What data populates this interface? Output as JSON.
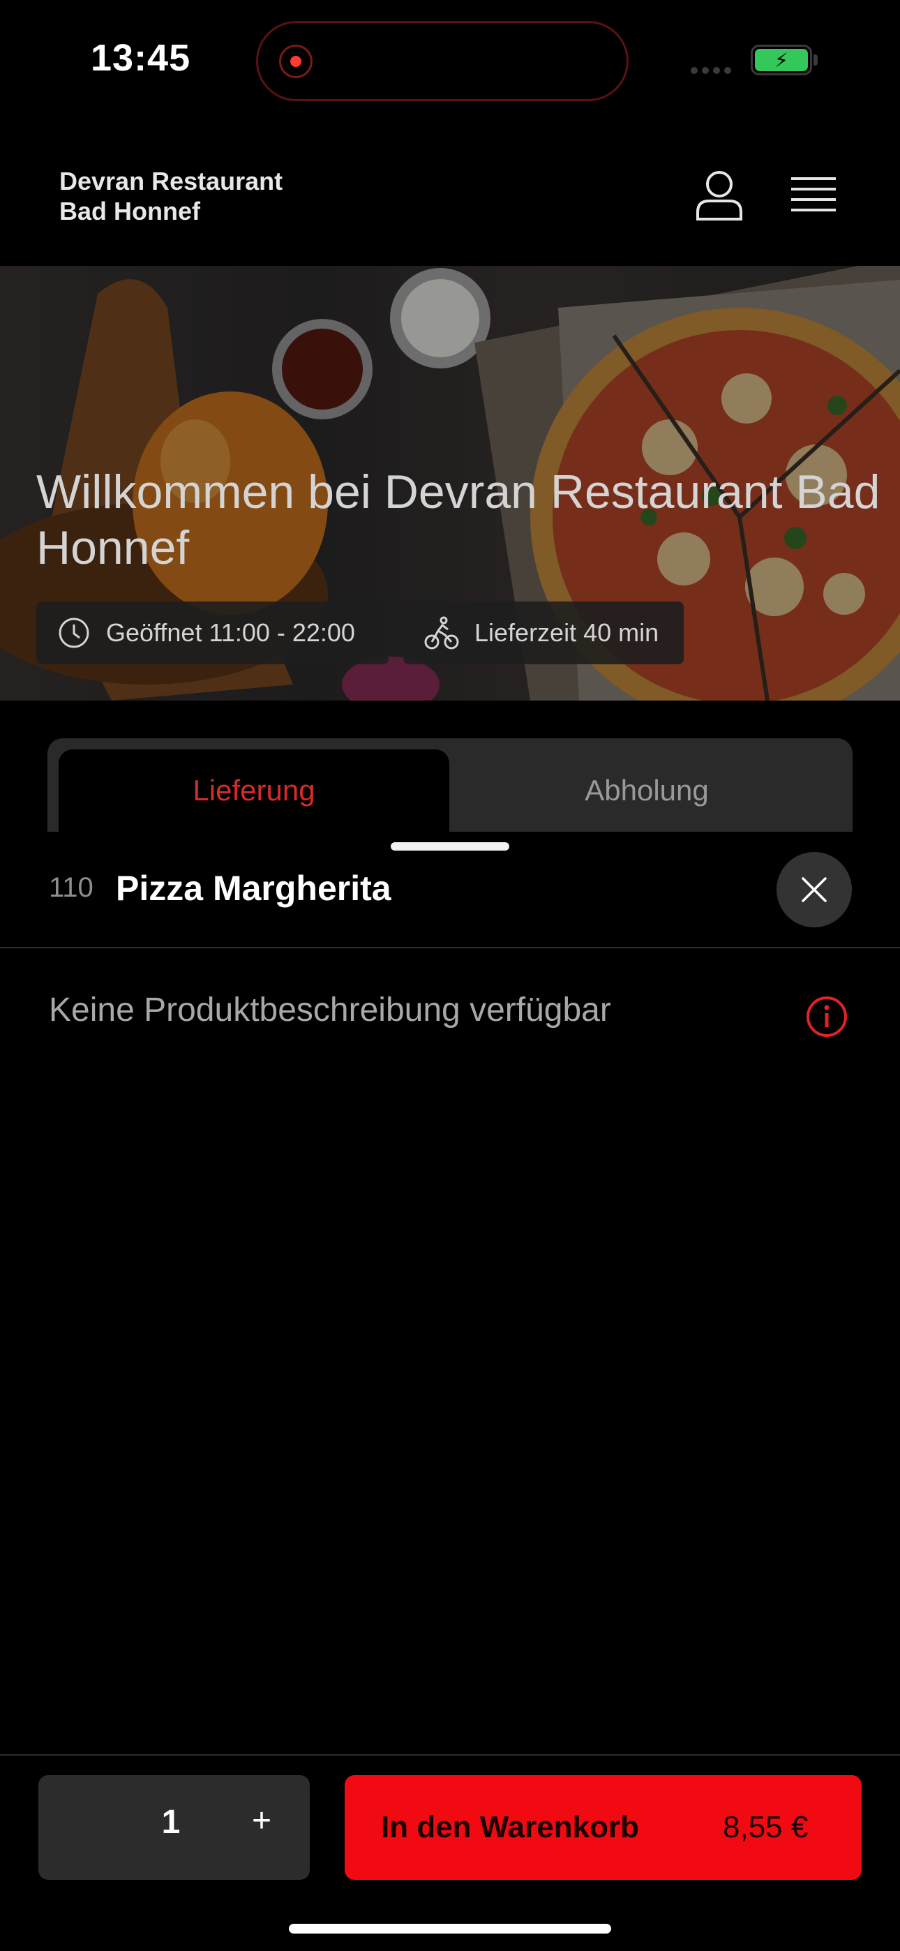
{
  "status_bar": {
    "time": "13:45"
  },
  "header": {
    "restaurant_line1": "Devran Restaurant",
    "restaurant_line2": "Bad Honnef",
    "user_icon": "user-icon",
    "menu_icon": "hamburger-menu-icon"
  },
  "hero": {
    "title": "Willkommen bei Devran Restaurant Bad Honnef",
    "hours_chip": "Geöffnet 11:00 - 22:00",
    "delivery_chip": "Lieferzeit 40 min"
  },
  "tabs": [
    {
      "label": "Lieferung",
      "active": true
    },
    {
      "label": "Abholung",
      "active": false
    }
  ],
  "product": {
    "number": "110",
    "name": "Pizza Margherita",
    "description": "Keine Produktbeschreibung verfügbar"
  },
  "order": {
    "quantity": "1",
    "plus_symbol": "+",
    "add_to_cart_label": "In den Warenkorb",
    "price": "8,55 €"
  },
  "colors": {
    "accent": "#f20a12",
    "active_tab_text": "#d52b2b",
    "battery": "#34c759"
  }
}
